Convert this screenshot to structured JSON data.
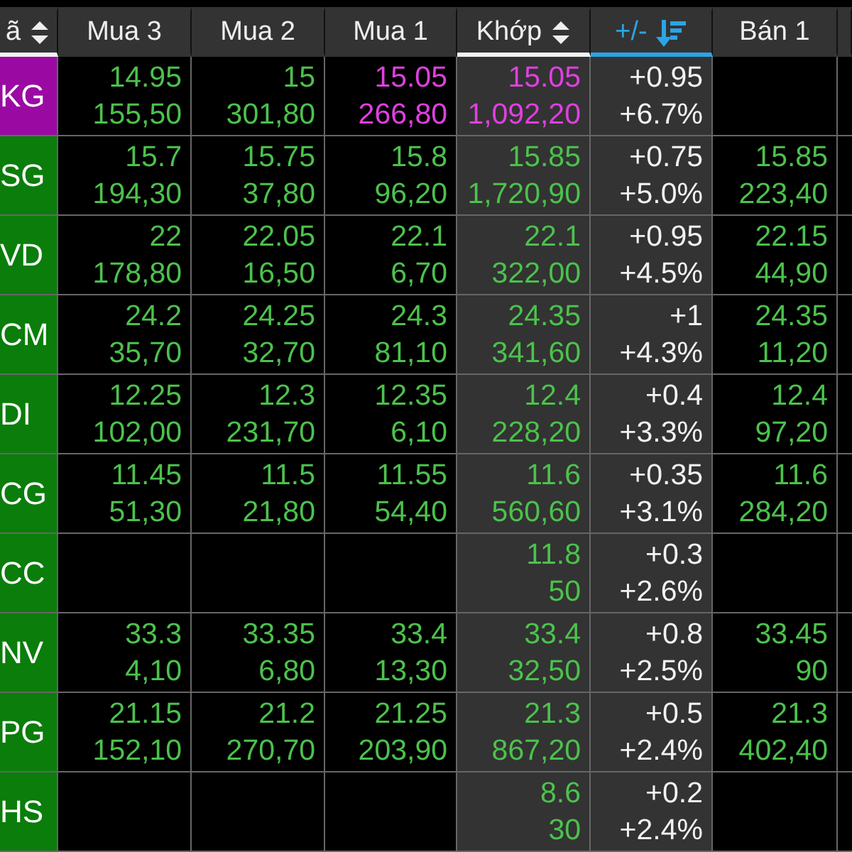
{
  "columns": [
    {
      "label": "ã",
      "kind": "sortable",
      "selected": false
    },
    {
      "label": "Mua 3",
      "kind": "plain",
      "selected": false
    },
    {
      "label": "Mua 2",
      "kind": "plain",
      "selected": false
    },
    {
      "label": "Mua 1",
      "kind": "plain",
      "selected": false
    },
    {
      "label": "Khớp",
      "kind": "sortable",
      "selected": false
    },
    {
      "label": "+/-",
      "kind": "sorted",
      "selected": true
    },
    {
      "label": "Bán 1",
      "kind": "plain",
      "selected": false
    }
  ],
  "rows": [
    {
      "ticker": {
        "text": "KG",
        "color": "#9a0aa3"
      },
      "bids": [
        {
          "price": "14.95",
          "volume": "155,50",
          "color": "#4cc24c"
        },
        {
          "price": "15",
          "volume": "301,80",
          "color": "#4cc24c"
        },
        {
          "price": "15.05",
          "volume": "266,80",
          "color": "#e040e0"
        }
      ],
      "match": {
        "price": "15.05",
        "volume": "1,092,20",
        "color": "#e040e0"
      },
      "change": {
        "value": "+0.95",
        "percent": "+6.7%"
      },
      "ask": {}
    },
    {
      "ticker": {
        "text": "SG",
        "color": "#0b7d0b"
      },
      "bids": [
        {
          "price": "15.7",
          "volume": "194,30",
          "color": "#4cc24c"
        },
        {
          "price": "15.75",
          "volume": "37,80",
          "color": "#4cc24c"
        },
        {
          "price": "15.8",
          "volume": "96,20",
          "color": "#4cc24c"
        }
      ],
      "match": {
        "price": "15.85",
        "volume": "1,720,90",
        "color": "#4cc24c"
      },
      "change": {
        "value": "+0.75",
        "percent": "+5.0%"
      },
      "ask": {
        "price": "15.85",
        "volume": "223,40",
        "color": "#4cc24c"
      }
    },
    {
      "ticker": {
        "text": "VD",
        "color": "#0b7d0b"
      },
      "bids": [
        {
          "price": "22",
          "volume": "178,80",
          "color": "#4cc24c"
        },
        {
          "price": "22.05",
          "volume": "16,50",
          "color": "#4cc24c"
        },
        {
          "price": "22.1",
          "volume": "6,70",
          "color": "#4cc24c"
        }
      ],
      "match": {
        "price": "22.1",
        "volume": "322,00",
        "color": "#4cc24c"
      },
      "change": {
        "value": "+0.95",
        "percent": "+4.5%"
      },
      "ask": {
        "price": "22.15",
        "volume": "44,90",
        "color": "#4cc24c"
      }
    },
    {
      "ticker": {
        "text": "CM",
        "color": "#0b7d0b"
      },
      "bids": [
        {
          "price": "24.2",
          "volume": "35,70",
          "color": "#4cc24c"
        },
        {
          "price": "24.25",
          "volume": "32,70",
          "color": "#4cc24c"
        },
        {
          "price": "24.3",
          "volume": "81,10",
          "color": "#4cc24c"
        }
      ],
      "match": {
        "price": "24.35",
        "volume": "341,60",
        "color": "#4cc24c"
      },
      "change": {
        "value": "+1",
        "percent": "+4.3%"
      },
      "ask": {
        "price": "24.35",
        "volume": "11,20",
        "color": "#4cc24c"
      }
    },
    {
      "ticker": {
        "text": "DI",
        "color": "#0b7d0b"
      },
      "bids": [
        {
          "price": "12.25",
          "volume": "102,00",
          "color": "#4cc24c"
        },
        {
          "price": "12.3",
          "volume": "231,70",
          "color": "#4cc24c"
        },
        {
          "price": "12.35",
          "volume": "6,10",
          "color": "#4cc24c"
        }
      ],
      "match": {
        "price": "12.4",
        "volume": "228,20",
        "color": "#4cc24c"
      },
      "change": {
        "value": "+0.4",
        "percent": "+3.3%"
      },
      "ask": {
        "price": "12.4",
        "volume": "97,20",
        "color": "#4cc24c"
      }
    },
    {
      "ticker": {
        "text": "CG",
        "color": "#0b7d0b"
      },
      "bids": [
        {
          "price": "11.45",
          "volume": "51,30",
          "color": "#4cc24c"
        },
        {
          "price": "11.5",
          "volume": "21,80",
          "color": "#4cc24c"
        },
        {
          "price": "11.55",
          "volume": "54,40",
          "color": "#4cc24c"
        }
      ],
      "match": {
        "price": "11.6",
        "volume": "560,60",
        "color": "#4cc24c"
      },
      "change": {
        "value": "+0.35",
        "percent": "+3.1%"
      },
      "ask": {
        "price": "11.6",
        "volume": "284,20",
        "color": "#4cc24c"
      }
    },
    {
      "ticker": {
        "text": "CC",
        "color": "#0b7d0b"
      },
      "match": {
        "price": "11.8",
        "volume": "50",
        "color": "#4cc24c"
      },
      "change": {
        "value": "+0.3",
        "percent": "+2.6%"
      },
      "ask": {}
    },
    {
      "ticker": {
        "text": "NV",
        "color": "#0b7d0b"
      },
      "bids": [
        {
          "price": "33.3",
          "volume": "4,10",
          "color": "#4cc24c"
        },
        {
          "price": "33.35",
          "volume": "6,80",
          "color": "#4cc24c"
        },
        {
          "price": "33.4",
          "volume": "13,30",
          "color": "#4cc24c"
        }
      ],
      "match": {
        "price": "33.4",
        "volume": "32,50",
        "color": "#4cc24c"
      },
      "change": {
        "value": "+0.8",
        "percent": "+2.5%"
      },
      "ask": {
        "price": "33.45",
        "volume": "90",
        "color": "#4cc24c"
      }
    },
    {
      "ticker": {
        "text": "PG",
        "color": "#0b7d0b"
      },
      "bids": [
        {
          "price": "21.15",
          "volume": "152,10",
          "color": "#4cc24c"
        },
        {
          "price": "21.2",
          "volume": "270,70",
          "color": "#4cc24c"
        },
        {
          "price": "21.25",
          "volume": "203,90",
          "color": "#4cc24c"
        }
      ],
      "match": {
        "price": "21.3",
        "volume": "867,20",
        "color": "#4cc24c"
      },
      "change": {
        "value": "+0.5",
        "percent": "+2.4%"
      },
      "ask": {
        "price": "21.3",
        "volume": "402,40",
        "color": "#4cc24c"
      }
    },
    {
      "ticker": {
        "text": "HS",
        "color": "#0b7d0b"
      },
      "match": {
        "price": "8.6",
        "volume": "30",
        "color": "#4cc24c"
      },
      "change": {
        "value": "+0.2",
        "percent": "+2.4%"
      },
      "ask": {}
    }
  ]
}
